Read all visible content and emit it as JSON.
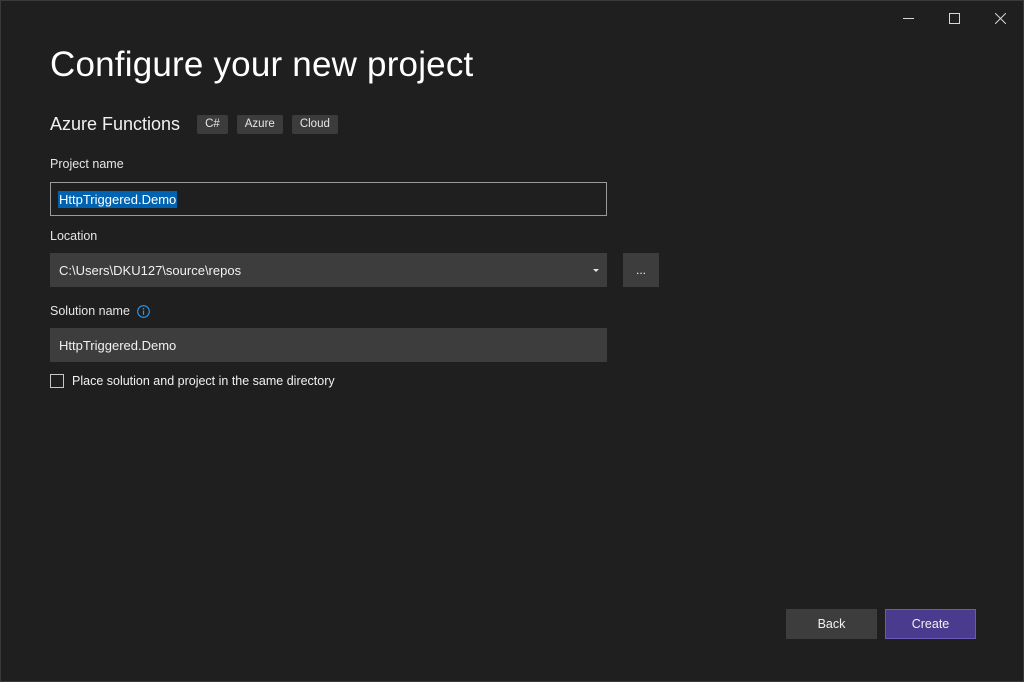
{
  "window": {
    "controls": {
      "minimize": "minimize-icon",
      "maximize": "maximize-icon",
      "close": "close-icon"
    }
  },
  "page": {
    "title": "Configure your new project",
    "template_name": "Azure Functions",
    "tags": [
      "C#",
      "Azure",
      "Cloud"
    ]
  },
  "form": {
    "project_name_label": "Project name",
    "project_name_value": "HttpTriggered.Demo",
    "location_label": "Location",
    "location_value": "C:\\Users\\DKU127\\source\\repos",
    "browse_label": "...",
    "solution_name_label": "Solution name",
    "solution_name_value": "HttpTriggered.Demo",
    "same_dir_label": "Place solution and project in the same directory",
    "same_dir_checked": false
  },
  "actions": {
    "back_label": "Back",
    "create_label": "Create"
  },
  "colors": {
    "background": "#1f1f1f",
    "field": "#3d3d3d",
    "selection": "#0063b1",
    "primary_button": "#4b3b8f",
    "info_icon": "#3a96dd"
  }
}
